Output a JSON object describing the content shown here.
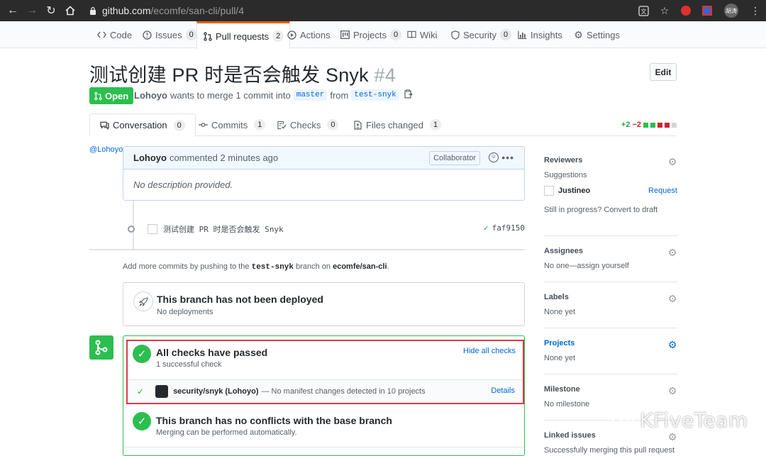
{
  "browser": {
    "url_host": "github.com",
    "url_path": "/ecomfe/san-cli/pull/4",
    "profile_label": "胡涛"
  },
  "repo_nav": {
    "tabs": [
      {
        "label": "Code",
        "icon": "code-icon",
        "count": ""
      },
      {
        "label": "Issues",
        "icon": "issue-icon",
        "count": "0"
      },
      {
        "label": "Pull requests",
        "icon": "pull-request-icon",
        "count": "2"
      },
      {
        "label": "Actions",
        "icon": "play-icon",
        "count": ""
      },
      {
        "label": "Projects",
        "icon": "project-icon",
        "count": "0"
      },
      {
        "label": "Wiki",
        "icon": "book-icon",
        "count": ""
      },
      {
        "label": "Security",
        "icon": "shield-icon",
        "count": "0"
      },
      {
        "label": "Insights",
        "icon": "graph-icon",
        "count": ""
      },
      {
        "label": "Settings",
        "icon": "gear-icon",
        "count": ""
      }
    ]
  },
  "pr": {
    "title": "测试创建 PR 时是否会触发 Snyk",
    "number": "#4",
    "edit_label": "Edit",
    "state": "Open",
    "author": "Lohoyo",
    "merge_text": "wants to merge 1 commit into",
    "base": "master",
    "from_text": "from",
    "head": "test-snyk"
  },
  "pr_tabs": [
    {
      "label": "Conversation",
      "icon": "comment-icon",
      "count": "0"
    },
    {
      "label": "Commits",
      "icon": "commit-icon",
      "count": "1"
    },
    {
      "label": "Checks",
      "icon": "checklist-icon",
      "count": "0"
    },
    {
      "label": "Files changed",
      "icon": "file-diff-icon",
      "count": "1"
    }
  ],
  "diffstat": {
    "additions": "+2",
    "deletions": "−2"
  },
  "comment": {
    "avatar_alt": "@Lohoyo",
    "author": "Lohoyo",
    "time": "commented 2 minutes ago",
    "role": "Collaborator",
    "body": "No description provided."
  },
  "commit": {
    "message": "测试创建 PR 时是否会触发 Snyk",
    "sha": "faf9150"
  },
  "hint": {
    "prefix": "Add more commits by pushing to the",
    "branch": "test-snyk",
    "middle": "branch on",
    "repo": "ecomfe/san-cli",
    "suffix": "."
  },
  "deploy": {
    "title": "This branch has not been deployed",
    "subtitle": "No deployments"
  },
  "checks": {
    "title": "All checks have passed",
    "subtitle": "1 successful check",
    "hide_label": "Hide all checks",
    "row_name": "security/snyk (Lohoyo)",
    "row_desc": "— No manifest changes detected in 10 projects",
    "details_label": "Details"
  },
  "conflicts": {
    "title": "This branch has no conflicts with the base branch",
    "subtitle": "Merging can be performed automatically."
  },
  "sidebar": {
    "reviewers": {
      "title": "Reviewers",
      "suggestions": "Suggestions",
      "user": "Justineo",
      "request": "Request",
      "draft": "Still in progress? Convert to draft"
    },
    "assignees": {
      "title": "Assignees",
      "text": "No one—assign yourself"
    },
    "labels": {
      "title": "Labels",
      "text": "None yet"
    },
    "projects": {
      "title": "Projects",
      "text": "None yet"
    },
    "milestone": {
      "title": "Milestone",
      "text": "No milestone"
    },
    "linked": {
      "title": "Linked issues",
      "text": "Successfully merging this pull request"
    }
  },
  "watermark": "KFiveTeam",
  "colors": {
    "accent": "#0366d6",
    "success": "#2cbe4e",
    "tab_active": "#e36209",
    "highlight": "#d73a49"
  }
}
